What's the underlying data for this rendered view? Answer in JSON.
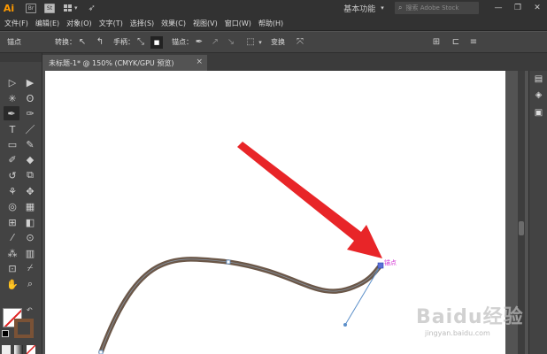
{
  "app": {
    "logo": "Ai",
    "br_label": "Br",
    "st_label": "St",
    "workspace": "基本功能",
    "search_placeholder": "搜索 Adobe Stock",
    "window_controls": [
      "—",
      "❐",
      "✕"
    ]
  },
  "menu": [
    "文件(F)",
    "编辑(E)",
    "对象(O)",
    "文字(T)",
    "选择(S)",
    "效果(C)",
    "视图(V)",
    "窗口(W)",
    "帮助(H)"
  ],
  "control_bar": {
    "selection_label": "锚点",
    "convert_label": "转换：",
    "handles_label": "手柄：",
    "anchor_label": "锚点：",
    "transform_label": "变换"
  },
  "document": {
    "tab_title": "未标题-1* @ 150% (CMYK/GPU 预览)",
    "close": "×"
  },
  "canvas": {
    "anchor_tooltip": "锚点",
    "stroke_color": "#6b5748",
    "handle_color": "#5b8fc9",
    "arrow_color": "#e82528"
  },
  "watermark": {
    "brand": "Baidu经验",
    "url": "jingyan.baidu.com"
  },
  "colors": {
    "ai_orange": "#ff9a00",
    "ui_dark": "#323232",
    "panel": "#434343",
    "canvas_bg": "#535353"
  }
}
